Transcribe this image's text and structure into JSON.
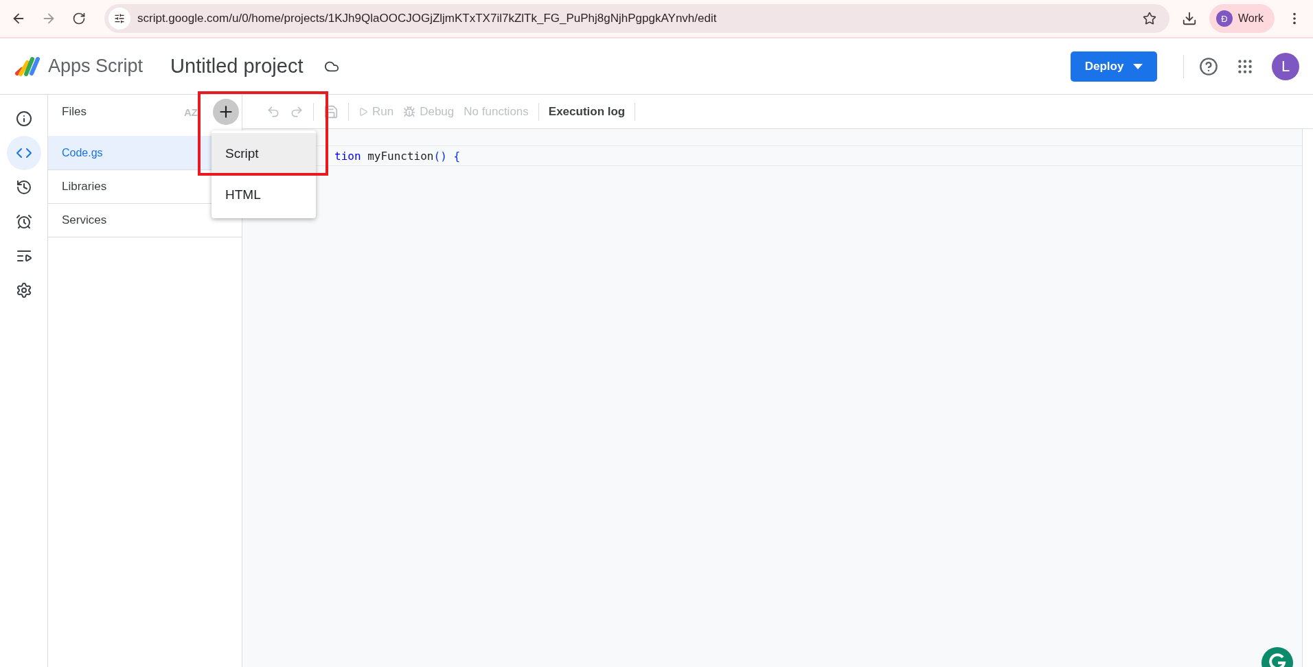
{
  "browser": {
    "url": "script.google.com/u/0/home/projects/1KJh9QlaOOCJOGjZljmKTxTX7il7kZlTk_FG_PuPhj8gNjhPgpgkAYnvh/edit",
    "profile_initial": "Đ",
    "profile_name": "Work"
  },
  "header": {
    "product": "Apps Script",
    "project_title": "Untitled project",
    "deploy": "Deploy",
    "avatar": "L"
  },
  "rail": [
    {
      "selected": false
    },
    {
      "selected": true
    },
    {
      "selected": false
    },
    {
      "selected": false
    },
    {
      "selected": false
    },
    {
      "selected": false
    }
  ],
  "files_panel": {
    "title": "Files",
    "sort_icon": "AZ",
    "files": [
      {
        "name": "Code.gs",
        "selected": true
      }
    ],
    "sections": [
      "Libraries",
      "Services"
    ]
  },
  "toolbar": {
    "run": "Run",
    "debug": "Debug",
    "function_select": "No functions",
    "execution_log": "Execution log"
  },
  "editor": {
    "tokens": [
      {
        "kind": "keyword",
        "text": "tion"
      },
      {
        "kind": "name",
        "text": " myFunction"
      },
      {
        "kind": "punct",
        "text": "() {"
      }
    ]
  },
  "add_menu": {
    "items": [
      {
        "label": "Script",
        "selected": true
      },
      {
        "label": "HTML",
        "selected": false
      }
    ]
  }
}
